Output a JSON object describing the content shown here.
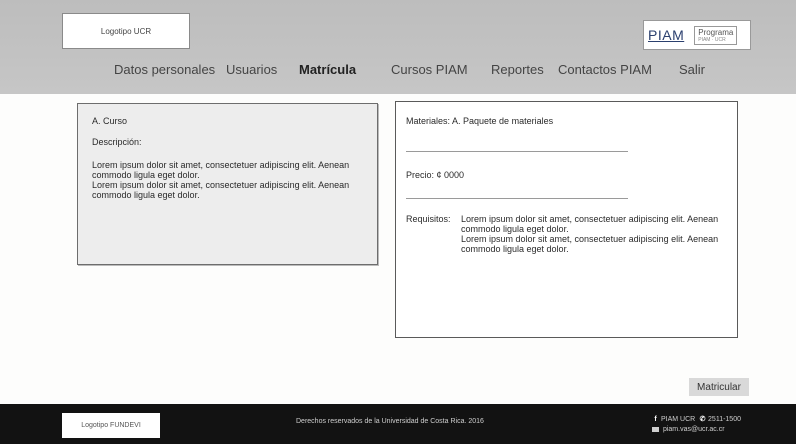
{
  "header": {
    "logo_left": "Logotipo UCR",
    "piam_logo": "PIAM",
    "programa_label": "Programa",
    "programa_sub": "PIAM · UCR"
  },
  "nav": {
    "items": [
      {
        "label": "Datos personales"
      },
      {
        "label": "Usuarios"
      },
      {
        "label": "Matrícula",
        "active": true
      },
      {
        "label": "Cursos PIAM"
      },
      {
        "label": "Reportes"
      },
      {
        "label": "Contactos PIAM"
      },
      {
        "label": "Salir"
      }
    ]
  },
  "course": {
    "title": "A. Curso",
    "desc_label": "Descripción:",
    "body_1": "Lorem ipsum dolor sit amet, consectetuer adipiscing elit. Aenean commodo ligula eget dolor.",
    "body_2": "Lorem ipsum dolor sit amet, consectetuer adipiscing elit. Aenean commodo ligula eget dolor."
  },
  "details": {
    "materials": "Materiales: A. Paquete de materiales",
    "price": "Precio: ¢ 0000",
    "req_label": "Requisitos:",
    "req_1": "Lorem ipsum dolor sit amet, consectetuer adipiscing elit. Aenean commodo ligula eget dolor.",
    "req_2": "Lorem ipsum dolor sit amet, consectetuer adipiscing elit. Aenean commodo ligula eget dolor."
  },
  "actions": {
    "enroll": "Matricular"
  },
  "footer": {
    "logo": "Logotipo FUNDEVI",
    "copyright": "Derechos reservados de la Universidad de Costa Rica. 2016",
    "facebook": "PIAM UCR",
    "phone": "2511-1500",
    "email": "piam.vas@ucr.ac.cr"
  },
  "colors": {
    "header_bg": "#c2c2c2",
    "footer_bg": "#121212",
    "panel_bg": "#ededed",
    "button_bg": "#d9d9d9"
  }
}
